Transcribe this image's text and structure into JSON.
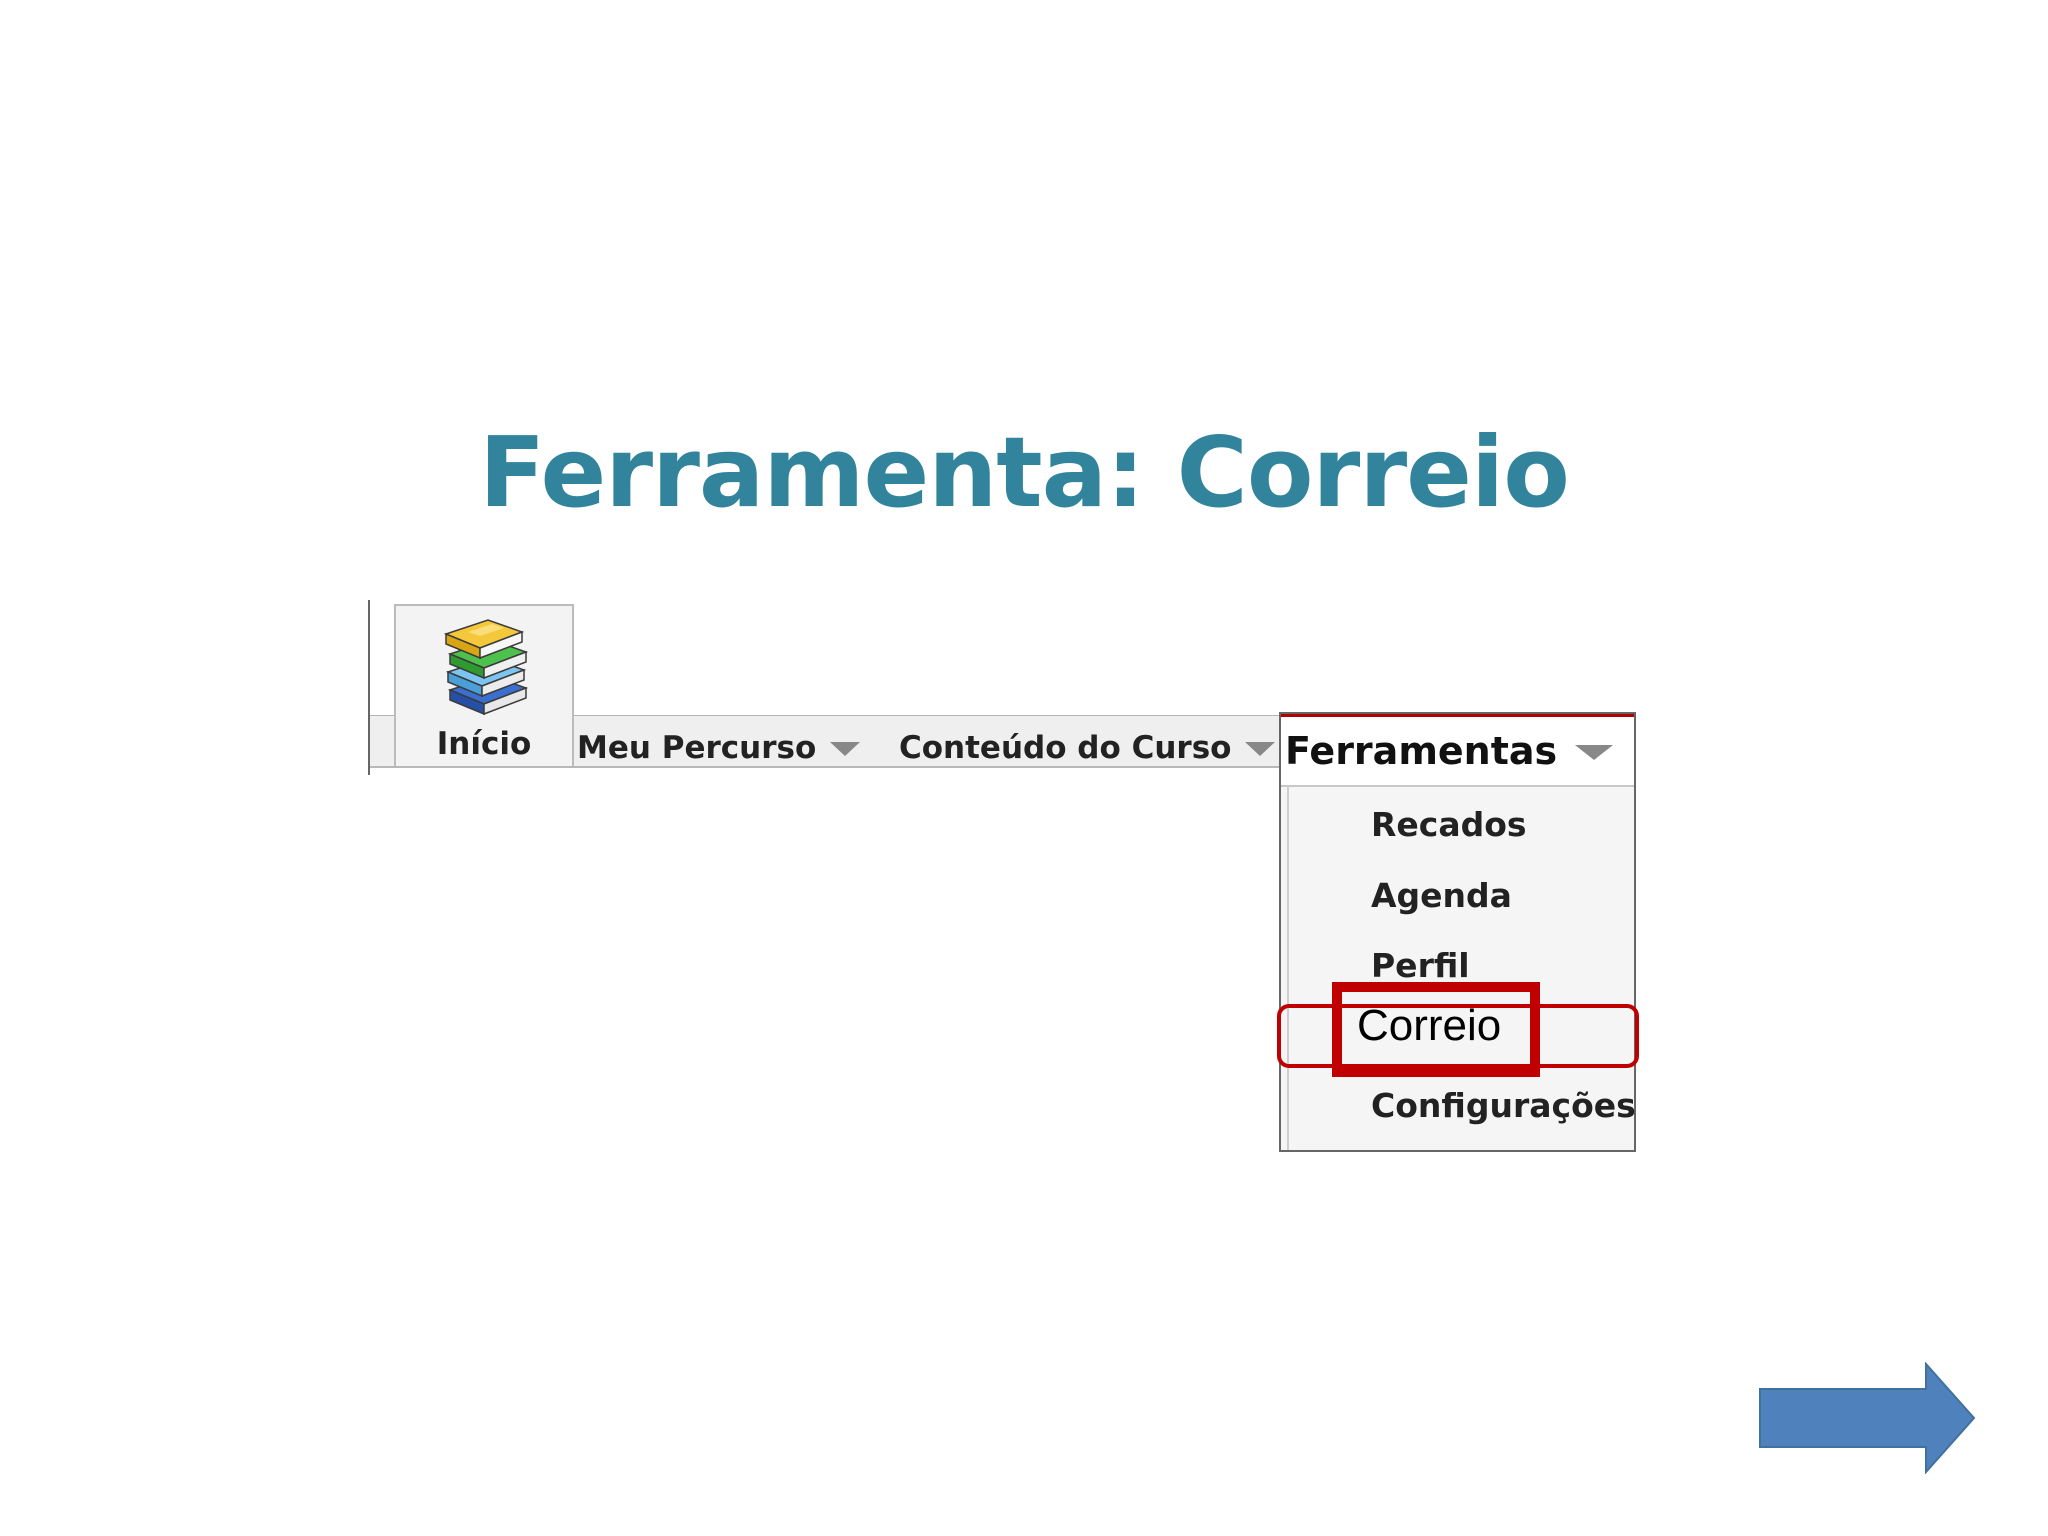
{
  "slide": {
    "title": "Ferramenta: Correio"
  },
  "nav": {
    "home_label": "Início",
    "home_icon": "books-icon",
    "items": [
      {
        "label": "Meu Percurso",
        "icon": "caret-down-icon"
      },
      {
        "label": "Conteúdo do Curso",
        "icon": "caret-down-icon"
      }
    ]
  },
  "menu": {
    "title": "Ferramentas",
    "title_icon": "caret-down-icon",
    "items": [
      {
        "label": "Recados"
      },
      {
        "label": "Agenda"
      },
      {
        "label": "Perfil"
      },
      {
        "label": "Correio",
        "highlighted": true
      },
      {
        "label": "Configurações"
      }
    ]
  },
  "colors": {
    "title": "#31849b",
    "highlight": "#c00000",
    "arrow": "#4f81bd"
  },
  "navigation": {
    "next_icon": "arrow-right-icon"
  }
}
